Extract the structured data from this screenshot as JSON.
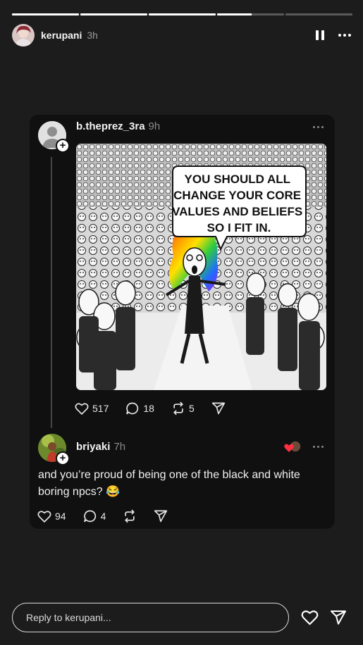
{
  "story": {
    "progress": [
      1,
      1,
      1,
      0.52,
      0
    ],
    "username": "kerupani",
    "time": "3h"
  },
  "post": {
    "username": "b.theprez_3ra",
    "time": "9h",
    "image": {
      "caption_lines": [
        "YOU SHOULD ALL",
        "CHANGE YOUR CORE",
        "VALUES AND BELIEFS",
        "SO I FIT IN."
      ]
    },
    "likes": "517",
    "comments": "18",
    "reposts": "5"
  },
  "reply": {
    "username": "briyaki",
    "time": "7h",
    "text": "and you’re proud of being one of the black and white boring npcs? 😂",
    "likes": "94",
    "comments": "4"
  },
  "reply_bar": {
    "placeholder": "Reply to kerupani..."
  },
  "colors": {
    "background": "#1c1c1c",
    "card": "#101010",
    "heart_red": "#ff3040"
  },
  "icons": [
    "pause-icon",
    "more-icon",
    "heart-icon",
    "comment-icon",
    "repost-icon",
    "share-icon"
  ]
}
